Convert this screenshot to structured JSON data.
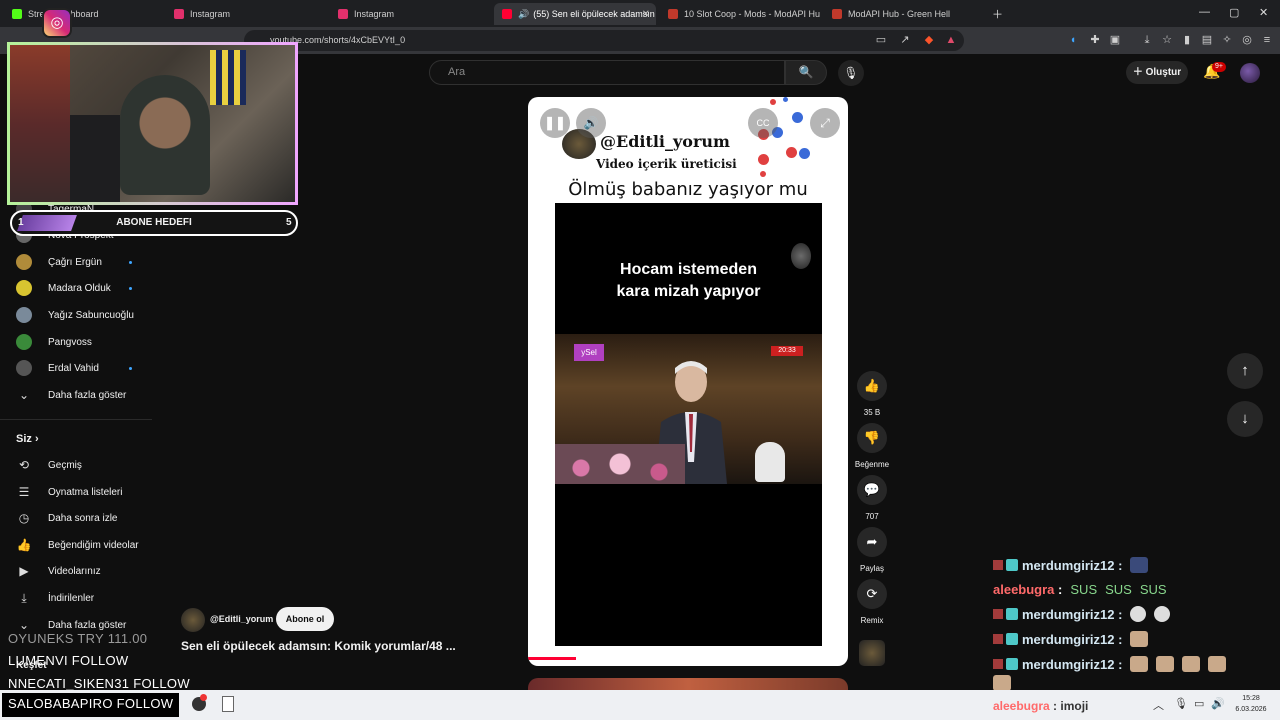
{
  "browser": {
    "tabs": [
      {
        "label": "Stre... Dashboard",
        "fav_color": "#53fc18"
      },
      {
        "label": "Instagram",
        "fav_color": "#e1306c"
      },
      {
        "label": "Instagram",
        "fav_color": "#e1306c"
      },
      {
        "label": "(55) Sen eli öpülecek adamsın",
        "fav_color": "#ff0033"
      },
      {
        "label": "10 Slot Coop - Mods - ModAPI Hub",
        "fav_color": "#c0392b"
      },
      {
        "label": "ModAPI Hub - Green Hell",
        "fav_color": "#c0392b"
      }
    ],
    "url": "youtube.com/shorts/4xCbEVYtI_0"
  },
  "header": {
    "search_placeholder": "Ara",
    "create_label": "Oluştur",
    "notif_badge": "9+"
  },
  "sidebar": {
    "subs": [
      {
        "label": "TagermaN",
        "color": "#444",
        "dot": false
      },
      {
        "label": "Nova Prospekt",
        "color": "#666",
        "dot": false
      },
      {
        "label": "Çağrı Ergün",
        "color": "#b08b3a",
        "dot": true
      },
      {
        "label": "Madara Olduk",
        "color": "#d8c430",
        "dot": true
      },
      {
        "label": "Yağız Sabuncuoğlu",
        "color": "#7a8a9a",
        "dot": false
      },
      {
        "label": "Pangvoss",
        "color": "#3a8a3a",
        "dot": false
      },
      {
        "label": "Erdal Vahid",
        "color": "#555",
        "dot": true
      }
    ],
    "show_more": "Daha fazla göster",
    "you_label": "Siz",
    "you_items": [
      {
        "icon": "history-icon",
        "glyph": "⟲",
        "label": "Geçmiş"
      },
      {
        "icon": "playlist-icon",
        "glyph": "☰",
        "label": "Oynatma listeleri"
      },
      {
        "icon": "watch-later-icon",
        "glyph": "◷",
        "label": "Daha sonra izle"
      },
      {
        "icon": "liked-icon",
        "glyph": "👍",
        "label": "Beğendiğim videolar"
      },
      {
        "icon": "your-videos-icon",
        "glyph": "▶",
        "label": "Videolarınız"
      },
      {
        "icon": "downloads-icon",
        "glyph": "⤓",
        "label": "İndirilenler"
      },
      {
        "icon": "chevron-down-icon",
        "glyph": "⌄",
        "label": "Daha fazla göster"
      }
    ],
    "explore_label": "Keşfet"
  },
  "overlay": {
    "goal_label": "ABONE HEDEFI",
    "goal_current": "1",
    "goal_target": "5",
    "goal_progress": 0.2
  },
  "short": {
    "handle": "@Editli_yorum",
    "subtitle": "Video içerik üreticisi",
    "title": "Ölmüş babanız yaşıyor mu",
    "caption_line1": "Hocam istemeden",
    "caption_line2": "kara mizah yapıyor",
    "tv_logo": "ySel",
    "tv_tag": "20:33",
    "cc_label": "CC",
    "progress": 0.15
  },
  "actions": {
    "likes": "35 B",
    "dislike": "Beğenme",
    "comments": "707",
    "share": "Paylaş",
    "remix": "Remix"
  },
  "meta": {
    "handle": "@Editli_yorum",
    "subscribe": "Abone ol",
    "title": "Sen eli öpülecek adamsın: Komik yorumlar/48 ..."
  },
  "alerts": [
    {
      "text": "OYUNEKS  TRY 111.00",
      "dim": true
    },
    {
      "text": "LUMENVI  FOLLOW",
      "dim": false
    },
    {
      "text": "NNECATI_SIKEN31  FOLLOW",
      "dim": false
    }
  ],
  "alert_black": "SALOBABAPIRO  FOLLOW",
  "chat": [
    {
      "user": "merdumgiriz12",
      "text": ":",
      "kind": "merd",
      "emotes": [
        "#3a4a7a"
      ]
    },
    {
      "user": "aleebugra",
      "text": ":",
      "kind": "ale",
      "sus": [
        "SUS",
        "SUS",
        "SUS"
      ]
    },
    {
      "user": "merdumgiriz12",
      "text": ":",
      "kind": "merd",
      "emotes": [
        "#ddd",
        "#ddd"
      ]
    },
    {
      "user": "merdumgiriz12",
      "text": ":",
      "kind": "merd",
      "emotes": [
        "#c9a98a"
      ]
    },
    {
      "user": "merdumgiriz12",
      "text": ":",
      "kind": "merd",
      "emotes": [
        "#c9a98a",
        "#c9a98a",
        "#c9a98a",
        "#c9a98a",
        "#c9a98a"
      ]
    },
    {
      "user": "aleebugra",
      "text": ": imoji",
      "kind": "ale"
    }
  ],
  "clock": {
    "time": "15:28",
    "date": "6.03.2026"
  }
}
